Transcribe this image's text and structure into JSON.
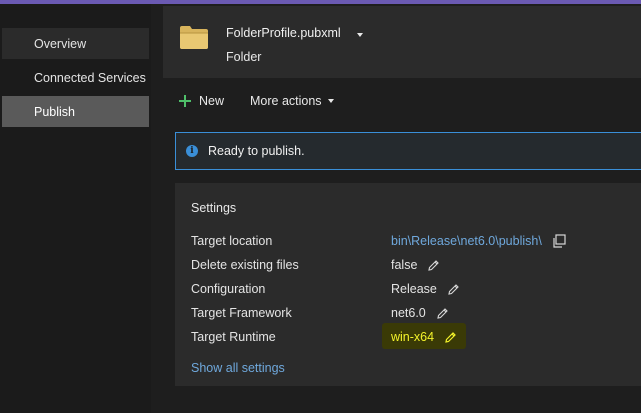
{
  "sidebar": {
    "items": [
      {
        "label": "Overview"
      },
      {
        "label": "Connected Services"
      },
      {
        "label": "Publish"
      }
    ]
  },
  "profile": {
    "name": "FolderProfile.pubxml",
    "type": "Folder",
    "icon": "folder-icon"
  },
  "toolbar": {
    "new_label": "New",
    "more_actions_label": "More actions"
  },
  "info": {
    "message": "Ready to publish.",
    "icon": "info-icon"
  },
  "settings": {
    "title": "Settings",
    "rows": [
      {
        "label": "Target location",
        "value": "bin\\Release\\net6.0\\publish\\"
      },
      {
        "label": "Delete existing files",
        "value": "false"
      },
      {
        "label": "Configuration",
        "value": "Release"
      },
      {
        "label": "Target Framework",
        "value": "net6.0"
      },
      {
        "label": "Target Runtime",
        "value": "win-x64"
      }
    ],
    "show_all_label": "Show all settings"
  },
  "colors": {
    "accent": "#6b5ab3",
    "link": "#6fa8dc",
    "info_border": "#3a8fd8",
    "highlight_text": "#f3f32a",
    "plus_green": "#4fbf6a"
  }
}
